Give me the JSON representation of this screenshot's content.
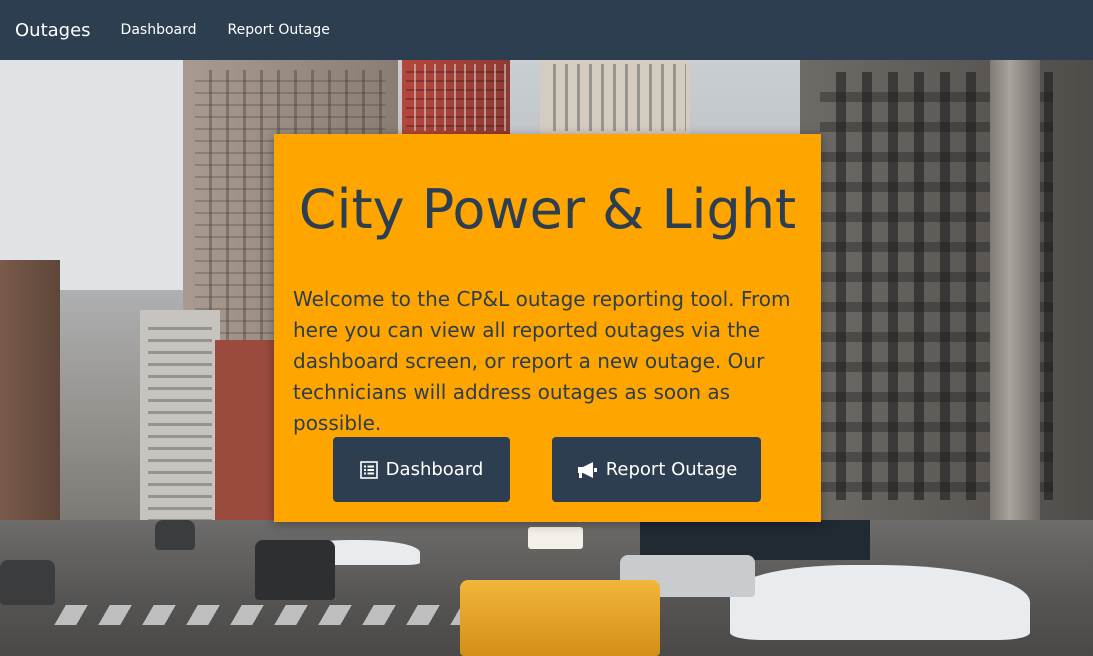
{
  "nav": {
    "brand": "Outages",
    "links": [
      {
        "label": "Dashboard"
      },
      {
        "label": "Report Outage"
      }
    ]
  },
  "hero": {
    "title": "City Power & Light",
    "body": "Welcome to the CP&L outage reporting tool. From here you can view all reported outages via the dashboard screen, or report a new outage. Our technicians will address outages as soon as possible.",
    "buttons": [
      {
        "label": "Dashboard",
        "icon": "list-icon"
      },
      {
        "label": "Report Outage",
        "icon": "bullhorn-icon"
      }
    ]
  },
  "colors": {
    "navbar": "#2c3e50",
    "card": "#ffa500",
    "button": "#2c3e50",
    "text": "#2c3e50"
  }
}
